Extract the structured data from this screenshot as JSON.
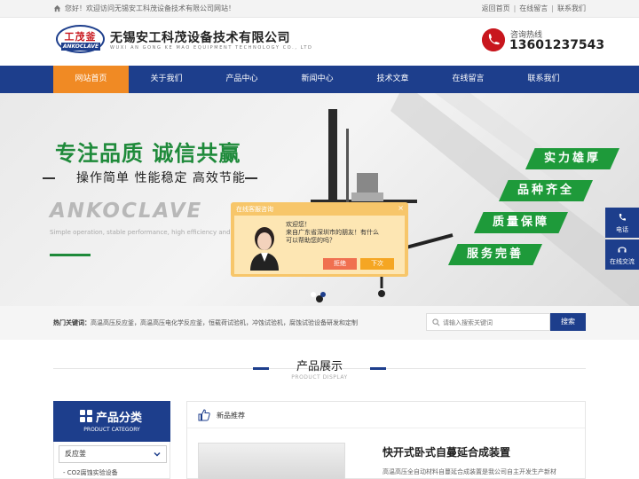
{
  "topbar": {
    "welcome": "您好！欢迎访问无锡安工科茂设备技术有限公司网站！",
    "links": [
      "返回首页",
      "在线留言",
      "联系我们"
    ]
  },
  "header": {
    "logo_cn": "工茂釜",
    "logo_en": "ANKOCLAVE",
    "company_name": "无锡安工科茂设备技术有限公司",
    "company_en": "WUXI AN GONG KE MAO EQUIPMENT TECHNOLOGY CO., LTD",
    "hotline_label": "咨询热线",
    "hotline_number": "13601237543"
  },
  "nav": {
    "items": [
      {
        "label": "网站首页",
        "active": true
      },
      {
        "label": "关于我们"
      },
      {
        "label": "产品中心"
      },
      {
        "label": "新闻中心"
      },
      {
        "label": "技术文章"
      },
      {
        "label": "在线留言"
      },
      {
        "label": "联系我们"
      }
    ]
  },
  "banner": {
    "slogan": "专注品质 诚信共赢",
    "sub": "操作简单 性能稳定 高效节能",
    "brand": "ANKOCLAVE",
    "tagline": "Simple operation, stable performance, high efficiency and energy saving",
    "tags": [
      "实力雄厚",
      "品种齐全",
      "质量保障",
      "服务完善"
    ],
    "slide_count": 2,
    "active_slide": 2
  },
  "chat": {
    "title": "在线客服咨询",
    "close": "×",
    "greeting": "欢迎您！",
    "line1": "来自广东省深圳市的朋友！有什么",
    "line2": "可以帮助您的吗？",
    "decline": "拒绝",
    "accept": "下次"
  },
  "float_bar": {
    "phone": "电话",
    "chat": "在线交流"
  },
  "keywords": {
    "label": "热门关键词：",
    "text": "高温高压反应釜，高温高压电化学反应釜，恒载荷试验机，冲蚀试验机，腐蚀试验设备研发和定制"
  },
  "search": {
    "placeholder": "请输入搜索关键词",
    "button": "搜索"
  },
  "products_section": {
    "title": "产品展示",
    "subtitle": "PRODUCT DISPLAY"
  },
  "category": {
    "title": "产品分类",
    "subtitle": "PRODUCT CATEGORY",
    "first": "反应釜",
    "sub_item": "CO2腐蚀实验设备"
  },
  "new_products": {
    "header": "新品推荐",
    "product_title": "快开式卧式自蔓延合成装置",
    "product_desc": "高温高压全自动材料自蔓延合成装置是我公司自主开发生产新材"
  },
  "colors": {
    "primary": "#1d3e8c",
    "accent": "#f08a24",
    "green": "#1e8a3a"
  }
}
